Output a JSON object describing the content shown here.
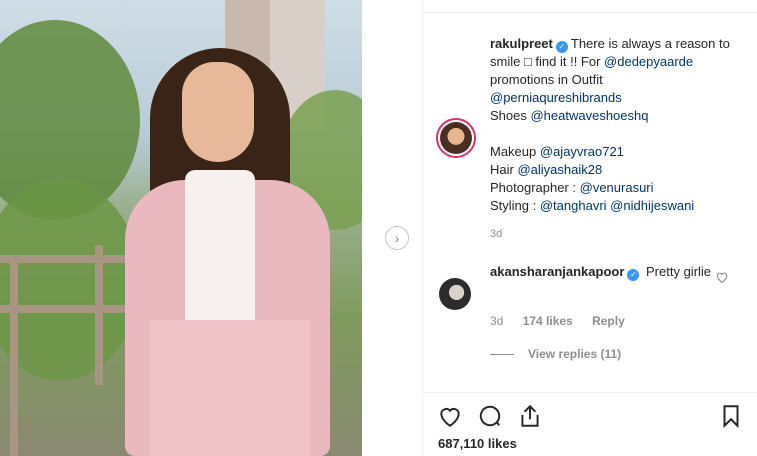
{
  "post": {
    "author": "rakulpreet",
    "caption_parts": [
      {
        "t": "There is always a reason to smile □ find it !! For ",
        "link": false
      },
      {
        "t": "@dedepyaarde",
        "link": true
      },
      {
        "t": " promotions in Outfit ",
        "link": false
      },
      {
        "t": "@perniaqureshibrands",
        "link": true
      },
      {
        "t": " Shoes ",
        "link": false
      },
      {
        "t": "@heatwaveshoeshq",
        "link": true
      }
    ],
    "credits": [
      {
        "label": "Makeup ",
        "handle": "@ajayvrao721"
      },
      {
        "label": "Hair ",
        "handle": "@aliyashaik28"
      },
      {
        "label": "Photographer : ",
        "handle": "@venurasuri"
      },
      {
        "label": "Styling : ",
        "handle": "@tanghavri",
        "handle2": "@nidhijeswani"
      }
    ],
    "time": "3d",
    "likes": "687,110 likes"
  },
  "comment": {
    "author": "akansharanjankapoor",
    "text": "Pretty girlie",
    "time": "3d",
    "likes": "174 likes",
    "reply": "Reply",
    "view_replies": "View replies (11)"
  },
  "icons": {
    "next": "chevron-right-icon",
    "like": "heart-icon",
    "comment": "comment-icon",
    "share": "share-icon",
    "save": "bookmark-icon"
  }
}
